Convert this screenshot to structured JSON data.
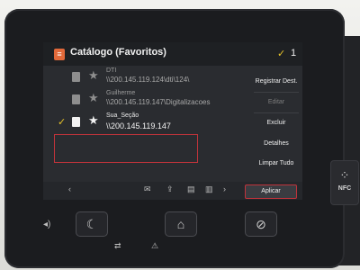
{
  "screen": {
    "title": "Catálogo (Favoritos)",
    "selected_count": "1",
    "entries": [
      {
        "name": "DTI",
        "address": "\\\\200.145.119.124\\dti\\124\\",
        "checked": false
      },
      {
        "name": "Guilherme",
        "address": "\\\\200.145.119.147\\Digitalizacoes",
        "checked": false
      },
      {
        "name": "Sua_Seção",
        "address": "\\\\200.145.119.147",
        "checked": true
      }
    ],
    "actions": {
      "register": "Registrar Dest.",
      "edit": "Editar",
      "delete": "Excluir",
      "details": "Detalhes",
      "clear_all": "Limpar Tudo"
    },
    "apply": "Aplicar"
  },
  "device": {
    "nfc": "NFC"
  },
  "icons": {
    "title": "address-book-icon",
    "check": "check-icon",
    "document": "document-icon",
    "star": "star-icon",
    "prev": "chevron-left-icon",
    "next": "chevron-right-icon",
    "home": "home-icon",
    "sleep": "sleep-icon",
    "stop": "stop-icon"
  },
  "colors": {
    "accent_check": "#e6c229",
    "highlight": "#c0333b",
    "title_icon": "#e2693a"
  }
}
